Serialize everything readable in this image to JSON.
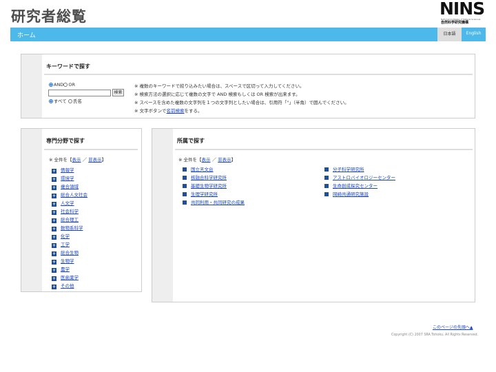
{
  "header": {
    "title": "研究者総覧",
    "logo_text": "NINS",
    "logo_subtitle": "National Institutes of Natural Sciences",
    "logo_japanese": "自然科学研究機構"
  },
  "nav": {
    "home": "ホーム",
    "lang_ja": "日本語",
    "lang_en": "English"
  },
  "keyword": {
    "heading": "キーワードで探す",
    "op_and": "AND",
    "op_or": "OR",
    "search_button": "検索",
    "scope_all": "すべて",
    "scope_name": "氏名",
    "notes": [
      "※ 複数のキーワードで絞り込みたい場合は、スペースで区切って入力してください。",
      "※ 検索方法の選択に応じて複数の文字で AND 検索もしくは OR 検索が出来ます。",
      "※ スペースを含めた複数の文字列を１つの文字列としたい場合は、引用符「\"」（半角）で囲んでください。"
    ],
    "note4_prefix": "※ 文字ボタンで",
    "note4_link": "名前検索",
    "note4_suffix": "をする。"
  },
  "specialty": {
    "heading": "専門分野で探す",
    "toggle_prefix": "※ 全件を【",
    "show": "表示",
    "sep": "／",
    "hide": "非表示",
    "toggle_suffix": "】",
    "items": [
      "情報学",
      "環境学",
      "複合領域",
      "総合人文社会",
      "人文学",
      "社会科学",
      "総合理工",
      "数物系科学",
      "化学",
      "工学",
      "総合生物",
      "生物学",
      "農学",
      "医歯薬学",
      "その他"
    ]
  },
  "affiliation": {
    "heading": "所属で探す",
    "toggle_prefix": "※ 全件を【",
    "show": "表示",
    "sep": "／",
    "hide": "非表示",
    "toggle_suffix": "】",
    "left_items": [
      "国立天文台",
      "核融合科学研究所",
      "基礎生物学研究所",
      "生理学研究所",
      "共同利用・共同研究の成果"
    ],
    "right_items": [
      "分子科学研究所",
      "アストロバイオロジーセンター",
      "生命創成探究センター",
      "岡崎共通研究施設"
    ]
  },
  "footer": {
    "page_top": "このページの先頭へ▲",
    "copyright": "Copyright (C) 2007 SRA Tohoku. All Rights Reserved."
  }
}
